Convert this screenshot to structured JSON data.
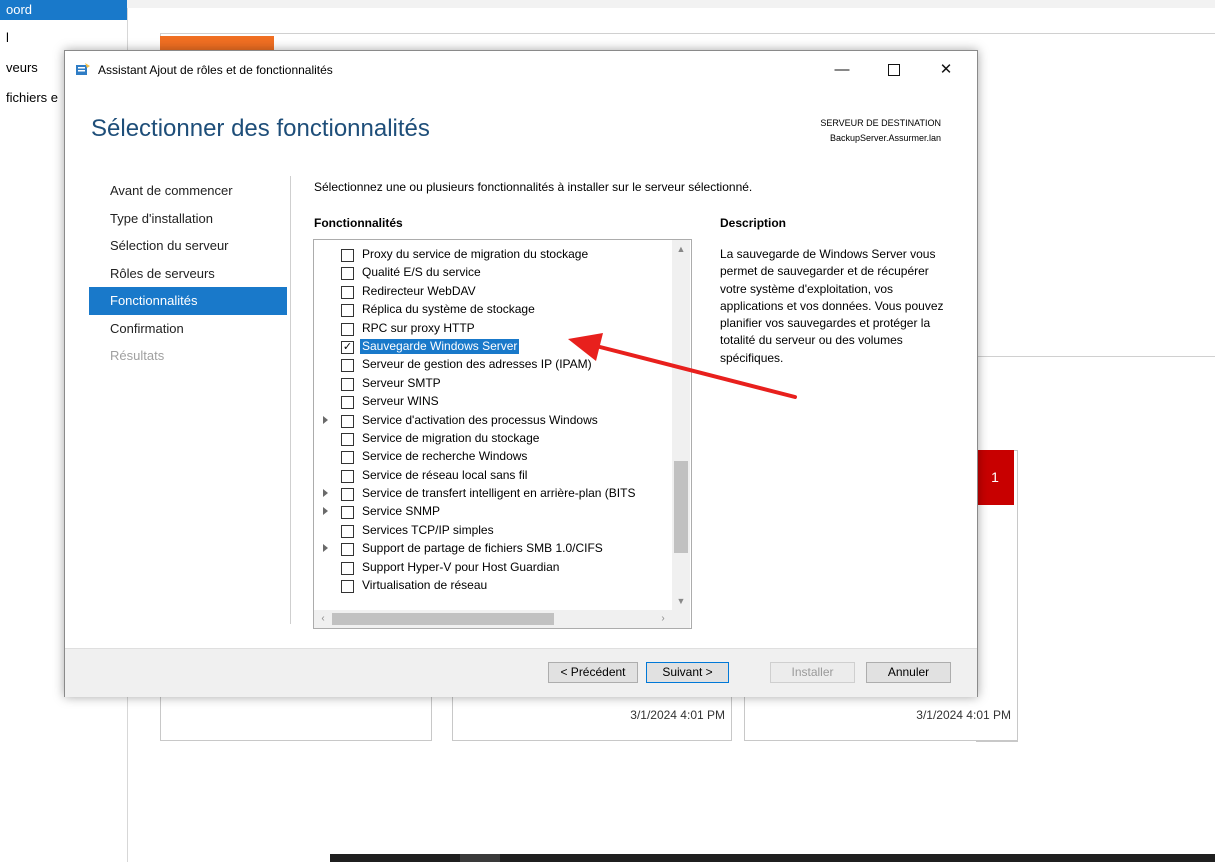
{
  "background": {
    "sidebar_items": [
      "oord",
      "l",
      "veurs",
      "fichiers e"
    ],
    "badge_count": "1",
    "card_timestamps": [
      "3/1/2024 4:01 PM",
      "3/1/2024 4:01 PM"
    ],
    "accent_color": "#1979ca",
    "orange_tile_color": "#f06f22",
    "badge_color": "#c80000"
  },
  "dialog": {
    "title": "Assistant Ajout de rôles et de fonctionnalités",
    "title_icon": "server-wizard-icon",
    "window_controls": {
      "minimize": "—",
      "close": "✕"
    },
    "page_title": "Sélectionner des fonctionnalités",
    "destination_label": "SERVEUR DE DESTINATION",
    "destination_server": "BackupServer.Assurmer.lan",
    "steps": [
      {
        "label": "Avant de commencer",
        "state": "normal"
      },
      {
        "label": "Type d'installation",
        "state": "normal"
      },
      {
        "label": "Sélection du serveur",
        "state": "normal"
      },
      {
        "label": "Rôles de serveurs",
        "state": "normal"
      },
      {
        "label": "Fonctionnalités",
        "state": "active"
      },
      {
        "label": "Confirmation",
        "state": "normal"
      },
      {
        "label": "Résultats",
        "state": "disabled"
      }
    ],
    "instruction": "Sélectionnez une ou plusieurs fonctionnalités à installer sur le serveur sélectionné.",
    "features_header": "Fonctionnalités",
    "features": [
      {
        "label": "Proxy du service de migration du stockage",
        "checked": false,
        "expandable": false
      },
      {
        "label": "Qualité E/S du service",
        "checked": false,
        "expandable": false
      },
      {
        "label": "Redirecteur WebDAV",
        "checked": false,
        "expandable": false
      },
      {
        "label": "Réplica du système de stockage",
        "checked": false,
        "expandable": false
      },
      {
        "label": "RPC sur proxy HTTP",
        "checked": false,
        "expandable": false
      },
      {
        "label": "Sauvegarde Windows Server",
        "checked": true,
        "expandable": false,
        "selected": true
      },
      {
        "label": "Serveur de gestion des adresses IP (IPAM)",
        "checked": false,
        "expandable": false
      },
      {
        "label": "Serveur SMTP",
        "checked": false,
        "expandable": false
      },
      {
        "label": "Serveur WINS",
        "checked": false,
        "expandable": false
      },
      {
        "label": "Service d'activation des processus Windows",
        "checked": false,
        "expandable": true
      },
      {
        "label": "Service de migration du stockage",
        "checked": false,
        "expandable": false
      },
      {
        "label": "Service de recherche Windows",
        "checked": false,
        "expandable": false
      },
      {
        "label": "Service de réseau local sans fil",
        "checked": false,
        "expandable": false
      },
      {
        "label": "Service de transfert intelligent en arrière-plan (BITS",
        "checked": false,
        "expandable": true
      },
      {
        "label": "Service SNMP",
        "checked": false,
        "expandable": true
      },
      {
        "label": "Services TCP/IP simples",
        "checked": false,
        "expandable": false
      },
      {
        "label": "Support de partage de fichiers SMB 1.0/CIFS",
        "checked": false,
        "expandable": true
      },
      {
        "label": "Support Hyper-V pour Host Guardian",
        "checked": false,
        "expandable": false
      },
      {
        "label": "Virtualisation de réseau",
        "checked": false,
        "expandable": false
      }
    ],
    "description_header": "Description",
    "description_text": "La sauvegarde de Windows Server vous permet de sauvegarder et de récupérer votre système d'exploitation, vos applications et vos données. Vous pouvez planifier vos sauvegardes et protéger la totalité du serveur ou des volumes spécifiques.",
    "buttons": {
      "previous": "< Précédent",
      "next": "Suivant >",
      "install": "Installer",
      "cancel": "Annuler"
    },
    "annotation_arrow_color": "#e8201d"
  }
}
